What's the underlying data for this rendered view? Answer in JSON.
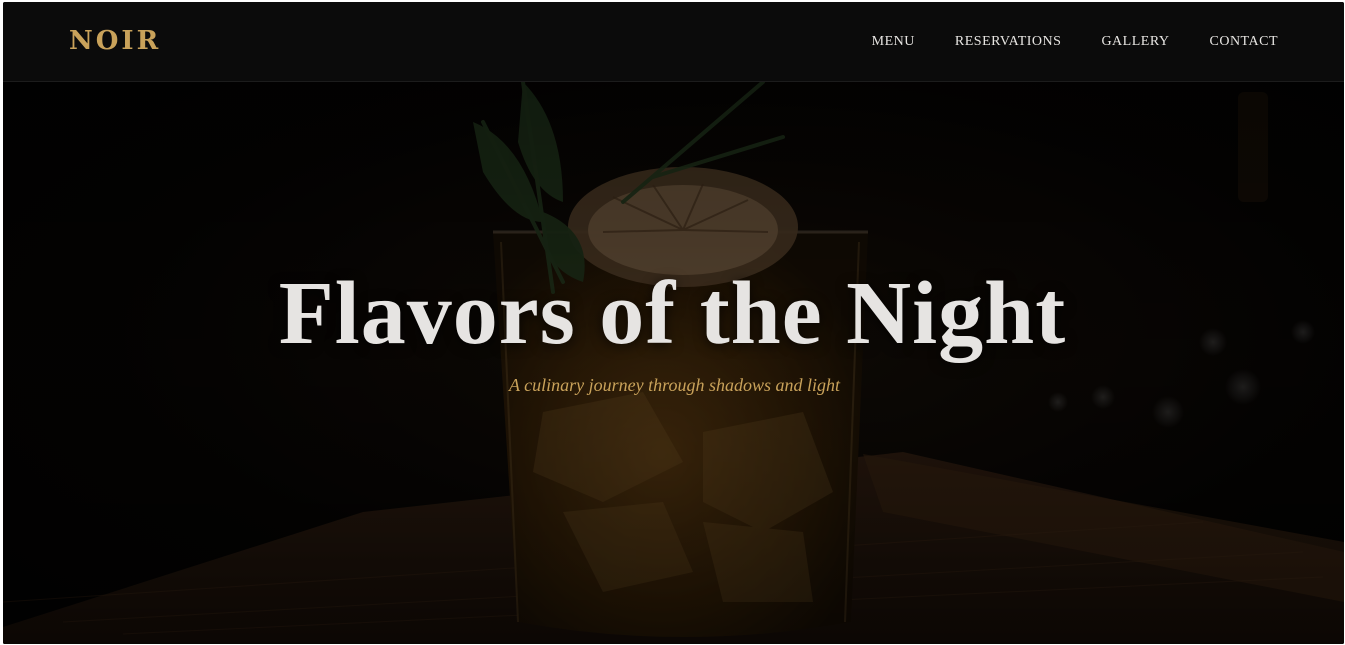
{
  "brand": {
    "logo": "NOIR",
    "accent_color": "#c9a25a"
  },
  "nav": {
    "items": [
      {
        "label": "MENU"
      },
      {
        "label": "RESERVATIONS"
      },
      {
        "label": "GALLERY"
      },
      {
        "label": "CONTACT"
      }
    ]
  },
  "hero": {
    "title": "Flavors of the Night",
    "subtitle": "A culinary journey through shadows and light",
    "image": "dark-cocktail-glass-on-wooden-tray"
  }
}
